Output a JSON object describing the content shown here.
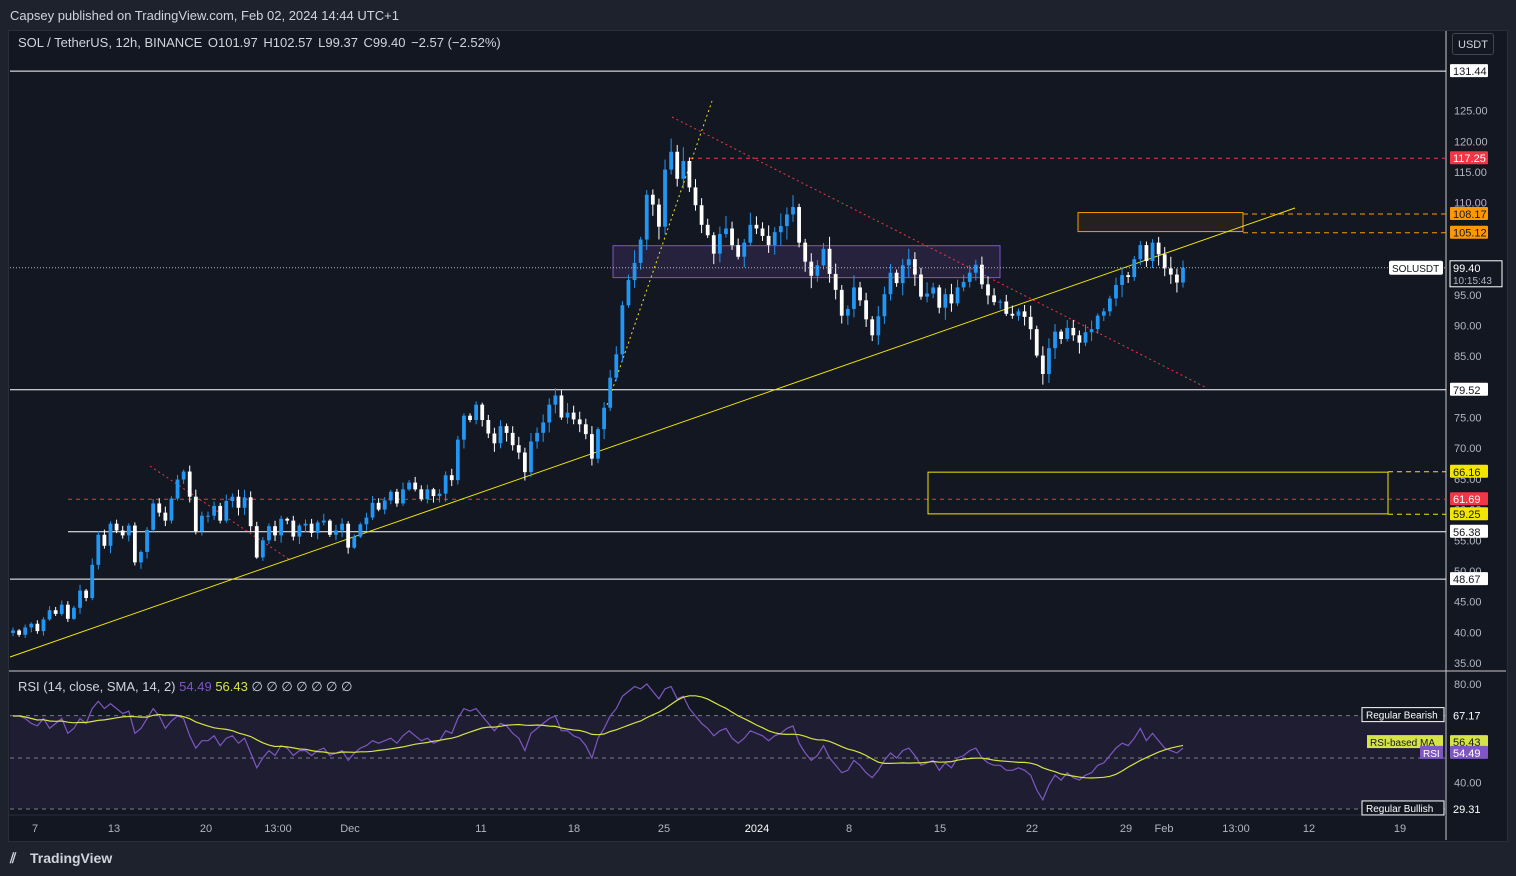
{
  "publisher": "Capsey published on TradingView.com, Feb 02, 2024 14:44 UTC+1",
  "symbol": {
    "pair": "SOL / TetherUS, 12h, BINANCE",
    "open": "O101.97",
    "high": "H102.57",
    "low": "L99.37",
    "close": "C99.40",
    "change": "−2.57 (−2.52%)"
  },
  "currency_button": "USDT",
  "footer": "TradingView",
  "rsi_header": {
    "label": "RSI (14, close, SMA, 14, 2)",
    "value_rsi": "54.49",
    "value_ma": "56.43",
    "nulls": "∅ ∅ ∅ ∅ ∅ ∅ ∅"
  },
  "colors": {
    "background": "#131722",
    "bull": "#2196f3",
    "bear": "#ffffff",
    "trendline": "#f2e600",
    "resistance_red": "#f23645",
    "orange": "#ff9800",
    "purple": "#7e57c2",
    "rsi_ma": "#d6e346"
  },
  "chart_data": [
    {
      "type": "candlestick",
      "title": "SOL / TetherUS, 12h, BINANCE",
      "ylim": [
        34,
        133
      ],
      "y_ticks": [
        35,
        40,
        45,
        50,
        55,
        60,
        65,
        70,
        75,
        80,
        85,
        90,
        95,
        100,
        105,
        110,
        115,
        120,
        125,
        130
      ],
      "x_tick_labels": [
        "7",
        "13",
        "20",
        "13:00",
        "Dec",
        "11",
        "18",
        "25",
        "2024",
        "8",
        "15",
        "22",
        "29",
        "Feb",
        "13:00",
        "12",
        "19"
      ],
      "candles_close": [
        40.3,
        39.6,
        40.8,
        41.4,
        40.2,
        42.1,
        43.6,
        43.0,
        44.5,
        42.2,
        44.0,
        46.8,
        45.6,
        51.0,
        55.9,
        54.1,
        57.7,
        56.6,
        55.8,
        57.4,
        51.4,
        53.1,
        56.7,
        61.0,
        59.5,
        58.2,
        61.8,
        64.9,
        66.2,
        62.1,
        56.5,
        59.0,
        59.0,
        60.6,
        58.2,
        61.4,
        62.1,
        60.3,
        62.0,
        57.3,
        52.2,
        55.0,
        57.3,
        55.8,
        58.5,
        58.2,
        55.6,
        57.4,
        57.7,
        56.2,
        57.9,
        58.2,
        55.9,
        56.6,
        57.7,
        53.8,
        55.6,
        57.6,
        58.7,
        61.1,
        60.0,
        61.5,
        62.9,
        61.0,
        63.3,
        64.4,
        63.3,
        61.7,
        63.3,
        62.2,
        62.6,
        65.6,
        64.8,
        71.4,
        75.3,
        74.6,
        77.1,
        74.6,
        72.4,
        70.8,
        73.6,
        72.5,
        70.5,
        69.3,
        66.1,
        71.1,
        72.5,
        74.2,
        77.1,
        78.6,
        75.0,
        75.8,
        74.7,
        73.9,
        72.3,
        68.3,
        73.1,
        76.6,
        81.5,
        85.3,
        93.3,
        97.4,
        100.2,
        104.0,
        111.3,
        109.7,
        106.1,
        115.4,
        118.3,
        113.9,
        116.8,
        112.5,
        109.6,
        106.4,
        104.7,
        101.7,
        104.9,
        105.8,
        103.1,
        101.2,
        103.5,
        106.4,
        105.8,
        104.6,
        103.1,
        105.2,
        106.2,
        108.1,
        109.3,
        103.5,
        100.4,
        98.1,
        99.8,
        102.5,
        98.4,
        95.8,
        91.6,
        92.7,
        96.2,
        94.1,
        91.0,
        88.4,
        91.5,
        95.1,
        98.6,
        96.9,
        99.8,
        100.8,
        98.3,
        94.7,
        95.2,
        96.2,
        92.9,
        95.1,
        93.6,
        96.2,
        97.1,
        98.6,
        99.9,
        96.7,
        94.9,
        93.8,
        93.9,
        91.9,
        91.6,
        92.3,
        91.4,
        89.4,
        85.1,
        82.1,
        86.3,
        89.0,
        87.8,
        89.6,
        88.4,
        87.2,
        88.9,
        89.4,
        91.6,
        92.3,
        94.4,
        96.6,
        98.2,
        97.9,
        100.8,
        103.1,
        100.5,
        103.5,
        101.6,
        99.3,
        98.3,
        97.0,
        99.4
      ],
      "horizontal_levels": [
        "131.44",
        "117.25",
        "108.17",
        "105.12",
        "79.52",
        "66.16",
        "61.69",
        "59.25",
        "56.38",
        "48.67"
      ],
      "last_price": {
        "symbol": "SOLUSDT",
        "price": "99.40",
        "countdown": "10:15:43"
      }
    },
    {
      "type": "line",
      "title": "RSI (14, close, SMA, 14, 2)",
      "ylim": [
        27,
        84
      ],
      "y_ticks": [
        40,
        80
      ],
      "series": [
        {
          "name": "RSI",
          "last": "54.49"
        },
        {
          "name": "RSI-based MA",
          "last": "56.43"
        }
      ],
      "bands": [
        {
          "name": "Regular Bearish",
          "value": "67.17"
        },
        {
          "name": "Regular Bullish",
          "value": "29.31"
        }
      ],
      "rsi_values": [
        67,
        67,
        66,
        64,
        63,
        66,
        62,
        64,
        66,
        60,
        62,
        66,
        64,
        70,
        73,
        70,
        72,
        70,
        68,
        69,
        60,
        62,
        66,
        70,
        67,
        62,
        65,
        67,
        66,
        59,
        54,
        57,
        57,
        59,
        55,
        58,
        59,
        56,
        58,
        52,
        46,
        50,
        53,
        51,
        55,
        54,
        51,
        53,
        53,
        51,
        53,
        54,
        51,
        52,
        53,
        49,
        52,
        54,
        55,
        57,
        56,
        57,
        58,
        56,
        59,
        61,
        59,
        57,
        58,
        56,
        57,
        61,
        60,
        66,
        70,
        69,
        70,
        67,
        64,
        61,
        64,
        63,
        60,
        58,
        53,
        60,
        62,
        64,
        66,
        67,
        61,
        61,
        59,
        58,
        55,
        50,
        58,
        62,
        67,
        70,
        75,
        77,
        79,
        78,
        80,
        77,
        74,
        78,
        79,
        74,
        75,
        70,
        67,
        64,
        62,
        59,
        61,
        62,
        58,
        56,
        58,
        61,
        60,
        59,
        57,
        59,
        60,
        62,
        63,
        56,
        52,
        49,
        51,
        55,
        50,
        47,
        44,
        45,
        49,
        47,
        44,
        42,
        45,
        49,
        52,
        50,
        53,
        54,
        51,
        47,
        48,
        49,
        45,
        48,
        46,
        50,
        51,
        53,
        54,
        50,
        48,
        47,
        47,
        45,
        45,
        46,
        45,
        43,
        37,
        33,
        39,
        43,
        41,
        44,
        42,
        41,
        43,
        44,
        47,
        48,
        51,
        54,
        56,
        55,
        58,
        62,
        57,
        60,
        57,
        54,
        53,
        52,
        54
      ]
    }
  ]
}
